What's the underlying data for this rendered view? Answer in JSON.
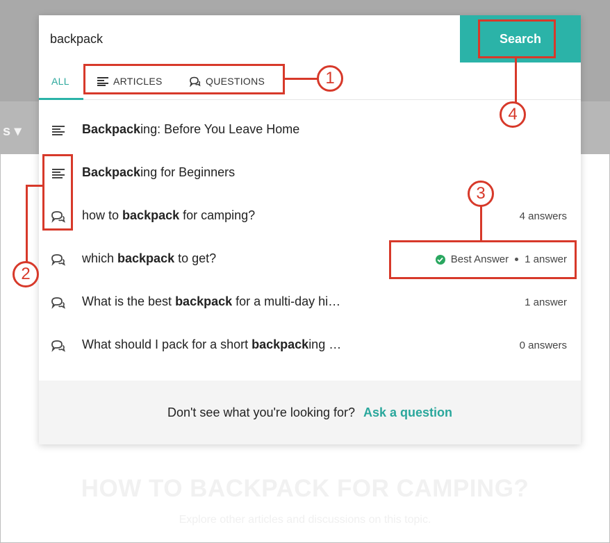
{
  "search": {
    "query": "backpack",
    "button_label": "Search"
  },
  "tabs": [
    {
      "label": "ALL",
      "active": true
    },
    {
      "label": "ARTICLES",
      "icon": "article-icon"
    },
    {
      "label": "QUESTIONS",
      "icon": "chat-bubble-icon"
    }
  ],
  "results": [
    {
      "type": "article",
      "icon": "article-icon",
      "bold": "Backpack",
      "rest": "ing: Before You Leave Home",
      "meta": ""
    },
    {
      "type": "article",
      "icon": "article-icon",
      "bold": "Backpack",
      "rest": "ing for Beginners",
      "meta": ""
    },
    {
      "type": "question",
      "icon": "chat-bubble-icon",
      "pre": "how to ",
      "bold": "backpack",
      "rest": " for camping?",
      "meta": "4 answers"
    },
    {
      "type": "question",
      "icon": "chat-bubble-icon",
      "pre": "which ",
      "bold": "backpack",
      "rest": " to get?",
      "best_answer": "Best Answer",
      "meta": "1 answer"
    },
    {
      "type": "question",
      "icon": "chat-bubble-icon",
      "pre": "What is the best ",
      "bold": "backpack",
      "rest": " for a multi-day hi…",
      "meta": "1 answer"
    },
    {
      "type": "question",
      "icon": "chat-bubble-icon",
      "pre": "What should I pack for a short ",
      "bold": "backpack",
      "rest": "ing …",
      "meta": "0 answers"
    }
  ],
  "footer": {
    "prompt": "Don't see what you're looking for?",
    "link": "Ask a question"
  },
  "background": {
    "nav_fragment": "s ▾",
    "heading": "HOW TO BACKPACK FOR CAMPING?",
    "subheading": "Explore other articles and discussions on this topic."
  },
  "annotations": {
    "callout_1": "1",
    "callout_2": "2",
    "callout_3": "3",
    "callout_4": "4"
  },
  "colors": {
    "accent": "#2bb3a8",
    "annotation": "#d7392a",
    "best_answer_check": "#2aa760"
  }
}
